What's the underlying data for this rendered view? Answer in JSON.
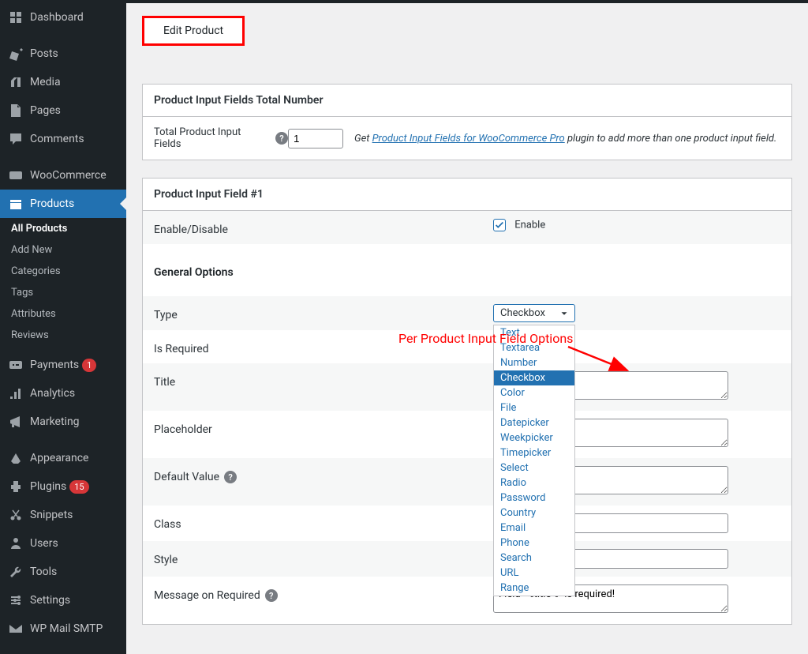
{
  "sidebar": {
    "items": [
      {
        "label": "Dashboard"
      },
      {
        "label": "Posts"
      },
      {
        "label": "Media"
      },
      {
        "label": "Pages"
      },
      {
        "label": "Comments"
      },
      {
        "label": "WooCommerce"
      },
      {
        "label": "Products"
      },
      {
        "label": "Payments",
        "badge": "1"
      },
      {
        "label": "Analytics"
      },
      {
        "label": "Marketing"
      },
      {
        "label": "Appearance"
      },
      {
        "label": "Plugins",
        "badge": "15"
      },
      {
        "label": "Snippets"
      },
      {
        "label": "Users"
      },
      {
        "label": "Tools"
      },
      {
        "label": "Settings"
      },
      {
        "label": "WP Mail SMTP"
      }
    ],
    "products_sub": [
      {
        "label": "All Products"
      },
      {
        "label": "Add New"
      },
      {
        "label": "Categories"
      },
      {
        "label": "Tags"
      },
      {
        "label": "Attributes"
      },
      {
        "label": "Reviews"
      }
    ]
  },
  "page": {
    "title": "Edit Product"
  },
  "panel1": {
    "heading": "Product Input Fields Total Number",
    "label": "Total Product Input Fields",
    "value": "1",
    "help_prefix": "Get ",
    "help_link": "Product Input Fields for WooCommerce Pro",
    "help_suffix": " plugin to add more than one product input field."
  },
  "panel2": {
    "heading": "Product Input Field #1",
    "rows": {
      "enable_label": "Enable/Disable",
      "enable_text": "Enable",
      "general_options": "General Options",
      "type": "Type",
      "type_value": "Checkbox",
      "is_required": "Is Required",
      "title": "Title",
      "placeholder": "Placeholder",
      "default_value": "Default Value",
      "class": "Class",
      "style": "Style",
      "msg_required": "Message on Required",
      "msg_required_value": "Field \"%title%\" is required!"
    },
    "dropdown": [
      "Text",
      "Textarea",
      "Number",
      "Checkbox",
      "Color",
      "File",
      "Datepicker",
      "Weekpicker",
      "Timepicker",
      "Select",
      "Radio",
      "Password",
      "Country",
      "Email",
      "Phone",
      "Search",
      "URL",
      "Range"
    ]
  },
  "annotation": "Per Product Input Field Options"
}
